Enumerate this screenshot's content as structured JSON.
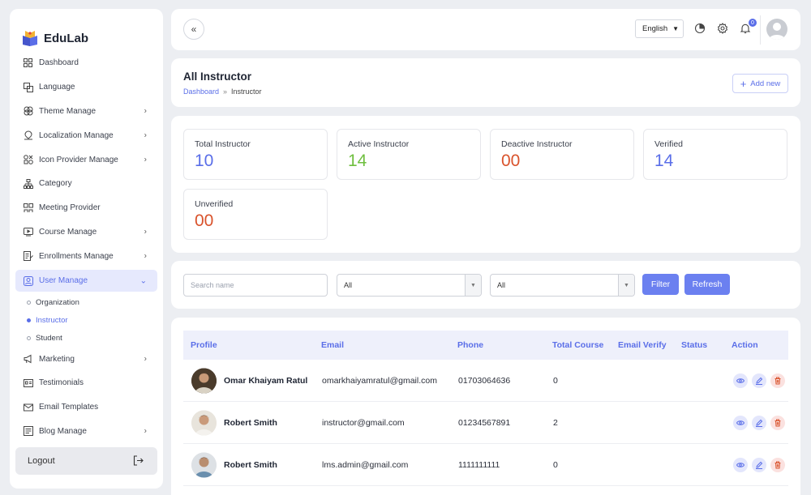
{
  "app": {
    "name": "EduLab"
  },
  "sidebar": {
    "items": [
      {
        "label": "Dashboard",
        "icon": "grid-icon",
        "chevron": false
      },
      {
        "label": "Language",
        "icon": "language-icon",
        "chevron": false
      },
      {
        "label": "Theme Manage",
        "icon": "theme-icon",
        "chevron": true
      },
      {
        "label": "Localization Manage",
        "icon": "map-pin-icon",
        "chevron": true
      },
      {
        "label": "Icon Provider Manage",
        "icon": "shapes-icon",
        "chevron": true
      },
      {
        "label": "Category",
        "icon": "hierarchy-icon",
        "chevron": false
      },
      {
        "label": "Meeting Provider",
        "icon": "meeting-icon",
        "chevron": false
      },
      {
        "label": "Course Manage",
        "icon": "video-icon",
        "chevron": true
      },
      {
        "label": "Enrollments Manage",
        "icon": "enroll-icon",
        "chevron": true
      },
      {
        "label": "User Manage",
        "icon": "user-icon",
        "chevron": true,
        "expanded": true
      },
      {
        "label": "Marketing",
        "icon": "megaphone-icon",
        "chevron": true
      },
      {
        "label": "Testimonials",
        "icon": "testimonial-icon",
        "chevron": false
      },
      {
        "label": "Email Templates",
        "icon": "mail-icon",
        "chevron": false
      },
      {
        "label": "Blog Manage",
        "icon": "blog-icon",
        "chevron": true
      }
    ],
    "user_sub": [
      "Organization",
      "Instructor",
      "Student"
    ],
    "logout_label": "Logout"
  },
  "header": {
    "language": "English",
    "notification_count": "0"
  },
  "page": {
    "title": "All Instructor",
    "breadcrumb": [
      "Dashboard",
      "»",
      "Instructor"
    ],
    "add_label": "Add new"
  },
  "stats": [
    {
      "label": "Total Instructor",
      "value": "10",
      "color": "#5a6ee8"
    },
    {
      "label": "Active Instructor",
      "value": "14",
      "color": "#6fbf3f"
    },
    {
      "label": "Deactive Instructor",
      "value": "00",
      "color": "#d9532c"
    },
    {
      "label": "Verified",
      "value": "14",
      "color": "#5a6ee8"
    },
    {
      "label": "Unverified",
      "value": "00",
      "color": "#d9532c"
    }
  ],
  "filters": {
    "search_placeholder": "Search name",
    "select1": "All",
    "select2": "All",
    "filter_label": "Filter",
    "refresh_label": "Refresh"
  },
  "table": {
    "headers": [
      "Profile",
      "Email",
      "Phone",
      "Total Course",
      "Email Verify",
      "Status",
      "Action"
    ],
    "rows": [
      {
        "name": "Omar Khaiyam Ratul",
        "email": "omarkhaiyamratul@gmail.com",
        "phone": "01703064636",
        "courses": "0",
        "email_verify": true,
        "status": true
      },
      {
        "name": "Robert Smith",
        "email": "instructor@gmail.com",
        "phone": "01234567891",
        "courses": "2",
        "email_verify": true,
        "status": true
      },
      {
        "name": "Robert Smith",
        "email": "lms.admin@gmail.com",
        "phone": "1111111111",
        "courses": "0",
        "email_verify": true,
        "status": true
      }
    ]
  },
  "colors": {
    "accent": "#5a6ee8",
    "success": "#6fbf3f",
    "danger": "#d9532c"
  }
}
